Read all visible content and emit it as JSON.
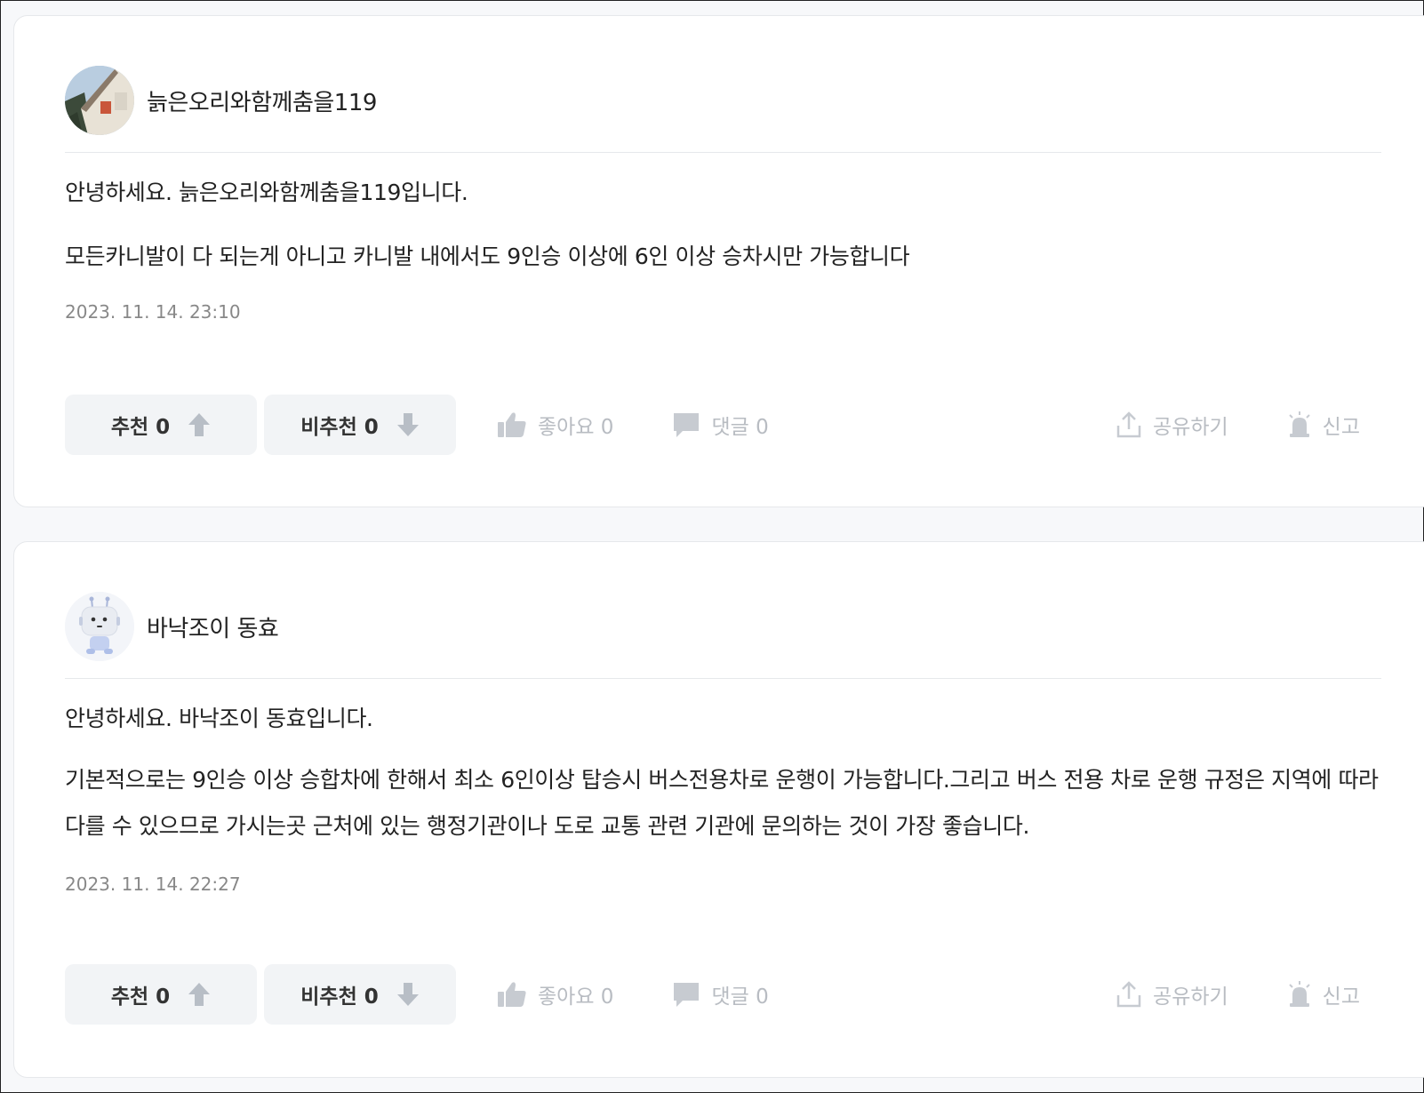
{
  "answers": [
    {
      "author": "늙은오리와함께춤을119",
      "avatar_icon": "profile-photo-house",
      "paragraphs": [
        "안녕하세요. 늙은오리와함께춤을119입니다.",
        "모든카니발이 다 되는게 아니고 카니발 내에서도 9인승 이상에 6인 이상 승차시만 가능합니다"
      ],
      "timestamp": "2023. 11. 14. 23:10",
      "actions": {
        "recommend_label": "추천 0",
        "not_recommend_label": "비추천 0",
        "like_label": "좋아요 0",
        "comment_label": "댓글 0",
        "share_label": "공유하기",
        "report_label": "신고"
      }
    },
    {
      "author": "바낙조이 동효",
      "avatar_icon": "robot-avatar",
      "paragraphs": [
        "안녕하세요. 바낙조이 동효입니다.",
        "기본적으로는 9인승 이상 승합차에 한해서 최소 6인이상 탑승시 버스전용차로 운행이 가능합니다.그리고 버스 전용 차로 운행 규정은 지역에 따라 다를 수 있으므로 가시는곳 근처에 있는 행정기관이나 도로 교통 관련 기관에 문의하는 것이 가장 좋습니다."
      ],
      "timestamp": "2023. 11. 14. 22:27",
      "actions": {
        "recommend_label": "추천 0",
        "not_recommend_label": "비추천 0",
        "like_label": "좋아요 0",
        "comment_label": "댓글 0",
        "share_label": "공유하기",
        "report_label": "신고"
      }
    }
  ],
  "colors": {
    "text": "#222222",
    "muted": "#888888",
    "action": "#b8bcc2",
    "button_bg": "#f2f4f6"
  }
}
